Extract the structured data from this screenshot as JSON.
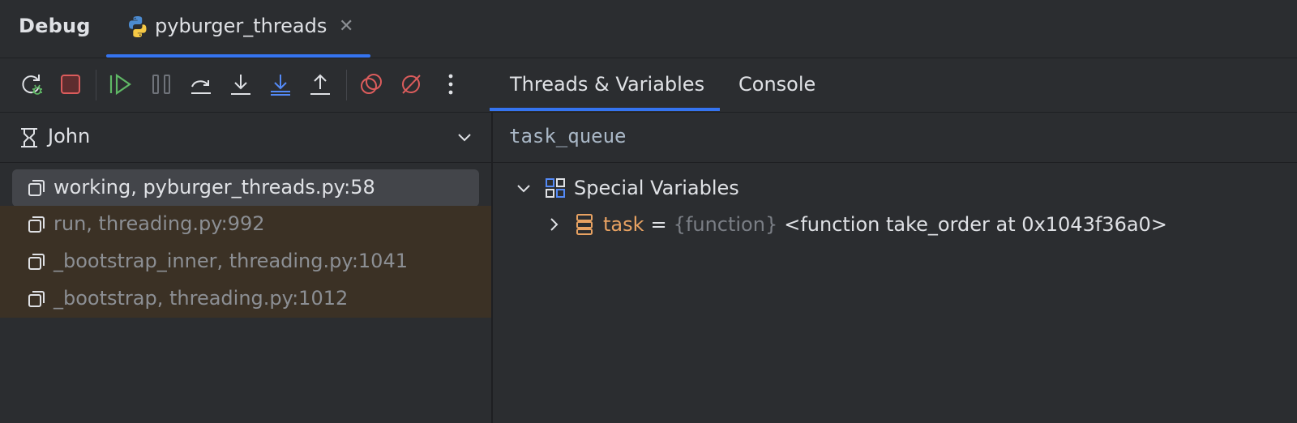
{
  "header": {
    "title": "Debug",
    "session_tab": "pyburger_threads",
    "close_symbol": "✕"
  },
  "toolbar": {
    "buttons": [
      {
        "name": "rerun-icon",
        "color": "#dfe1e5"
      },
      {
        "name": "stop-icon",
        "color": "#db5c5c"
      },
      {
        "name": "resume-icon",
        "color": "#5fb865"
      },
      {
        "name": "pause-icon",
        "color": "#6f737a"
      },
      {
        "name": "step-over-icon",
        "color": "#dfe1e5"
      },
      {
        "name": "step-into-icon",
        "color": "#dfe1e5"
      },
      {
        "name": "step-into-my-code-icon",
        "color": "#548af7"
      },
      {
        "name": "step-out-icon",
        "color": "#dfe1e5"
      },
      {
        "name": "view-breakpoints-icon",
        "color": "#db5c5c"
      },
      {
        "name": "mute-breakpoints-icon",
        "color": "#db5c5c"
      },
      {
        "name": "more-icon",
        "color": "#dfe1e5"
      }
    ],
    "tabs": [
      "Threads & Variables",
      "Console"
    ],
    "active_tab": "Threads & Variables"
  },
  "threads": {
    "current_thread": "John",
    "frames": [
      {
        "label": "working, pyburger_threads.py:58",
        "selected": true,
        "library": false
      },
      {
        "label": "run, threading.py:992",
        "selected": false,
        "library": true
      },
      {
        "label": "_bootstrap_inner, threading.py:1041",
        "selected": false,
        "library": true
      },
      {
        "label": "_bootstrap, threading.py:1012",
        "selected": false,
        "library": true
      }
    ]
  },
  "variables": {
    "expression": "task_queue",
    "special_variables_label": "Special Variables",
    "items": [
      {
        "name": "task",
        "eq": "=",
        "type": "{function}",
        "value": "<function take_order at 0x1043f36a0>"
      }
    ]
  },
  "colors": {
    "accent": "#3574f0",
    "library_frame_bg": "#3b3125",
    "selected_frame_bg": "#43454a",
    "variable_name": "#e8a262"
  }
}
